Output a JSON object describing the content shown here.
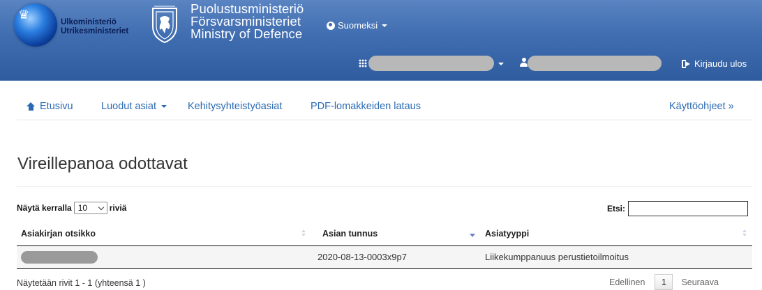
{
  "header": {
    "ministry_fi_sv": [
      "Ulkoministeriö",
      "Utrikesministeriet"
    ],
    "defence_title": [
      "Puolustusministeriö",
      "Försvarsministeriet",
      "Ministry of Defence"
    ],
    "language": "Suomeksi",
    "logout_label": "Kirjaudu ulos",
    "icons": {
      "language": "globe-icon",
      "apps": "apps-grid-icon",
      "user": "user-icon",
      "logout": "logout-icon"
    }
  },
  "nav": {
    "home": "Etusivu",
    "created": "Luodut asiat",
    "development": "Kehitysyhteistyöasiat",
    "pdf": "PDF-lomakkeiden lataus",
    "help": "Käyttöohjeet »"
  },
  "main": {
    "title": "Vireillepanoa odottavat",
    "length_prefix": "Näytä kerralla",
    "length_value": "10",
    "length_suffix": "riviä",
    "search_label": "Etsi:",
    "search_value": "",
    "columns": [
      "Asiakirjan otsikko",
      "Asian tunnus",
      "Asiatyyppi"
    ],
    "rows": [
      {
        "title": "",
        "case_id": "2020-08-13-0003x9p7",
        "type": "Liikekumppanuus perustietoilmoitus"
      }
    ],
    "info": "Näytetään rivit 1 - 1 (yhteensä 1 )",
    "pager": {
      "prev": "Edellinen",
      "page": "1",
      "next": "Seuraava"
    }
  },
  "colors": {
    "header_bg": "#3f6db0",
    "link": "#2a6ab2",
    "row_bg": "#f5f5f5"
  }
}
